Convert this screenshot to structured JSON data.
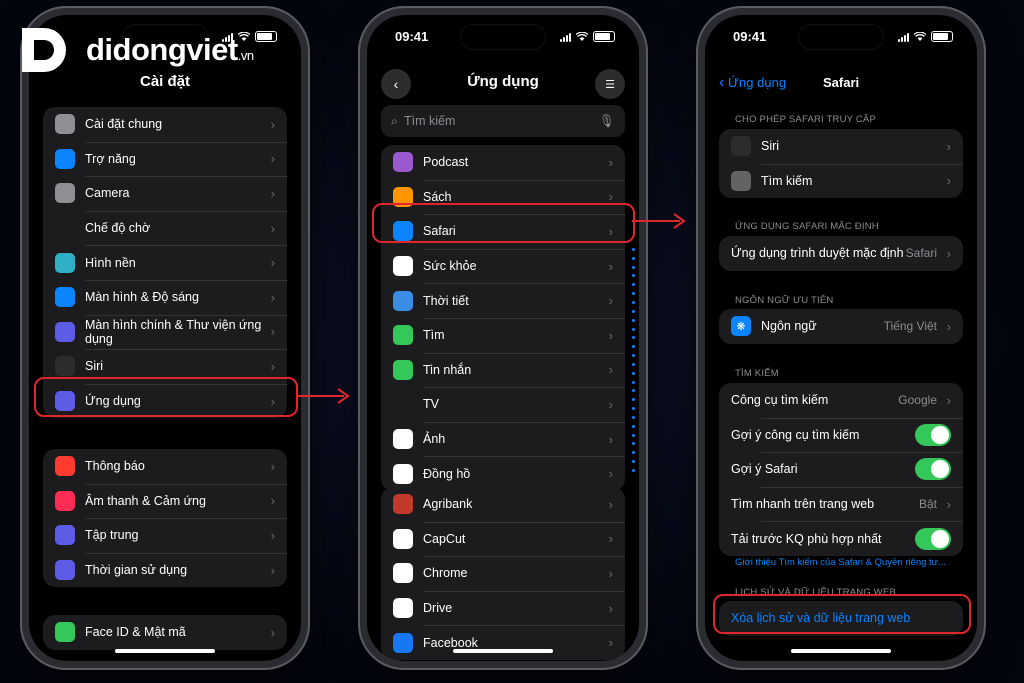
{
  "brand": {
    "name": "didongviet",
    "tld": ".vn"
  },
  "status": {
    "time": "09:41"
  },
  "phone1": {
    "title": "Cài đặt",
    "group1": [
      {
        "label": "Cài đặt chung",
        "icon": "gear-icon",
        "color": "#8e8e93"
      },
      {
        "label": "Trợ năng",
        "icon": "accessibility-icon",
        "color": "#0a84ff"
      },
      {
        "label": "Camera",
        "icon": "camera-icon",
        "color": "#8e8e93"
      },
      {
        "label": "Chế độ chờ",
        "icon": "standby-icon",
        "color": "#1c1c1e"
      },
      {
        "label": "Hình nền",
        "icon": "wallpaper-icon",
        "color": "#30b0c7"
      },
      {
        "label": "Màn hình & Độ sáng",
        "icon": "brightness-icon",
        "color": "#0a84ff"
      },
      {
        "label": "Màn hình chính & Thư viện ứng dụng",
        "icon": "home-screen-icon",
        "color": "#5e5ce6"
      },
      {
        "label": "Siri",
        "icon": "siri-icon",
        "color": "#2c2c2e"
      },
      {
        "label": "Ứng dụng",
        "icon": "apps-grid-icon",
        "color": "#5e5ce6"
      }
    ],
    "group2": [
      {
        "label": "Thông báo",
        "icon": "bell-icon",
        "color": "#ff3b30"
      },
      {
        "label": "Âm thanh & Cảm ứng",
        "icon": "speaker-icon",
        "color": "#ff2d55"
      },
      {
        "label": "Tập trung",
        "icon": "moon-icon",
        "color": "#5e5ce6"
      },
      {
        "label": "Thời gian sử dụng",
        "icon": "hourglass-icon",
        "color": "#5e5ce6"
      }
    ],
    "group3": [
      {
        "label": "Face ID & Mật mã",
        "icon": "face-id-icon",
        "color": "#34c759"
      }
    ]
  },
  "phone2": {
    "title": "Ứng dụng",
    "search_placeholder": "Tìm kiếm",
    "group1": [
      {
        "label": "Podcast",
        "icon": "podcast-icon",
        "color": "#9b59d0"
      },
      {
        "label": "Sách",
        "icon": "book-icon",
        "color": "#ff9500"
      },
      {
        "label": "Safari",
        "icon": "safari-compass-icon",
        "color": "#0a84ff"
      },
      {
        "label": "Sức khỏe",
        "icon": "heart-icon",
        "color": "#ffffff"
      },
      {
        "label": "Thời tiết",
        "icon": "weather-icon",
        "color": "#3a8ee6"
      },
      {
        "label": "Tìm",
        "icon": "find-my-icon",
        "color": "#34c759"
      },
      {
        "label": "Tin nhắn",
        "icon": "message-icon",
        "color": "#34c759"
      },
      {
        "label": "TV",
        "icon": "tv-icon",
        "color": "#1c1c1e"
      },
      {
        "label": "Ảnh",
        "icon": "photos-icon",
        "color": "#ffffff"
      },
      {
        "label": "Đồng hồ",
        "icon": "clock-icon",
        "color": "#ffffff"
      }
    ],
    "group2": [
      {
        "label": "Agribank",
        "icon": "agribank-icon",
        "color": "#c0392b"
      },
      {
        "label": "CapCut",
        "icon": "capcut-icon",
        "color": "#ffffff"
      },
      {
        "label": "Chrome",
        "icon": "chrome-icon",
        "color": "#ffffff"
      },
      {
        "label": "Drive",
        "icon": "drive-icon",
        "color": "#ffffff"
      },
      {
        "label": "Facebook",
        "icon": "facebook-icon",
        "color": "#1877f2"
      }
    ]
  },
  "phone3": {
    "back_label": "Ứng dụng",
    "title": "Safari",
    "sec_access": "CHO PHÉP SAFARI TRUY CẬP",
    "access_rows": [
      {
        "label": "Siri",
        "icon": "siri-icon",
        "color": "#2c2c2e"
      },
      {
        "label": "Tìm kiếm",
        "icon": "search-icon",
        "color": "#636366"
      }
    ],
    "sec_default": "ỨNG DỤNG SAFARI MẶC ĐỊNH",
    "default_row": {
      "label": "Ứng dụng trình duyệt mặc định",
      "value": "Safari"
    },
    "sec_lang": "NGÔN NGỮ ƯU TIÊN",
    "lang_row": {
      "label": "Ngôn ngữ",
      "value": "Tiếng Việt",
      "icon": "globe-icon",
      "color": "#0a84ff"
    },
    "sec_search": "TÌM KIẾM",
    "search_rows": [
      {
        "label": "Công cụ tìm kiếm",
        "value": "Google",
        "kind": "value"
      },
      {
        "label": "Gợi ý công cụ tìm kiếm",
        "kind": "toggle",
        "on": true
      },
      {
        "label": "Gợi ý Safari",
        "kind": "toggle",
        "on": true
      },
      {
        "label": "Tìm nhanh trên trang web",
        "value": "Bật",
        "kind": "value"
      },
      {
        "label": "Tải trước KQ phù hợp nhất",
        "kind": "toggle",
        "on": true
      }
    ],
    "privacy_link": "Giới thiệu Tìm kiếm của Safari & Quyền riêng tư...",
    "sec_history": "LỊCH SỬ VÀ DỮ LIỆU TRANG WEB",
    "clear_history": "Xóa lịch sử và dữ liệu trang web"
  },
  "colors": {
    "highlight": "#e0262a",
    "accent": "#0a84ff",
    "toggle_on": "#34c759"
  }
}
